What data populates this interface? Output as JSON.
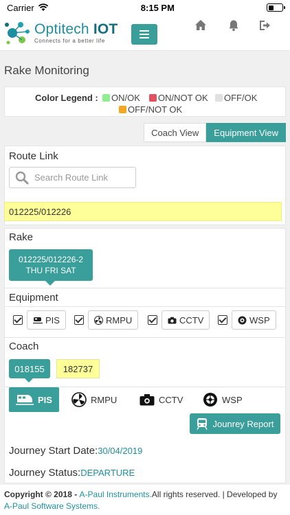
{
  "status_bar": {
    "carrier": "Carrier",
    "time": "8:15 PM"
  },
  "header": {
    "brand": "Optitech",
    "brand_suffix": "IOT",
    "tagline": "Connects for a better life"
  },
  "page": {
    "title": "Rake Monitoring"
  },
  "legend": {
    "label": "Color Legend :",
    "items": [
      {
        "label": "ON/OK",
        "color": "#90ee90"
      },
      {
        "label": "ON/NOT OK",
        "color": "#e05260"
      },
      {
        "label": "OFF/OK",
        "color": "#e0e0e0"
      },
      {
        "label": "OFF/NOT OK",
        "color": "#f5a623"
      }
    ]
  },
  "view_tabs": {
    "coach": "Coach View",
    "equipment": "Equipment View",
    "active": "equipment"
  },
  "route": {
    "label": "Route Link",
    "search_placeholder": "Search Route Link",
    "selected": "012225/012226"
  },
  "rake": {
    "label": "Rake",
    "line1": "012225/012226-2",
    "line2": "THU FRI SAT"
  },
  "equipment": {
    "label": "Equipment",
    "items": [
      {
        "label": "PIS",
        "icon": "train-icon",
        "checked": true
      },
      {
        "label": "RMPU",
        "icon": "fan-icon",
        "checked": true
      },
      {
        "label": "CCTV",
        "icon": "camera-icon",
        "checked": true
      },
      {
        "label": "WSP",
        "icon": "wheel-icon",
        "checked": true
      }
    ]
  },
  "coach": {
    "label": "Coach",
    "active": "018155",
    "other": "182737"
  },
  "equipment_tabs": [
    "PIS",
    "RMPU",
    "CCTV",
    "WSP"
  ],
  "report_button": "Jounrey Report",
  "journey": {
    "start_label": "Journey Start Date:",
    "start_value": "30/04/2019",
    "status_label": "Journey Status:",
    "status_value": "DEPARTURE"
  },
  "footer": {
    "copyright": "Copyright © 2018 - ",
    "company": "A-Paul Instruments.",
    "rights": "All rights reserved. | Developed by ",
    "developer": "A-Paul Software Systems."
  }
}
